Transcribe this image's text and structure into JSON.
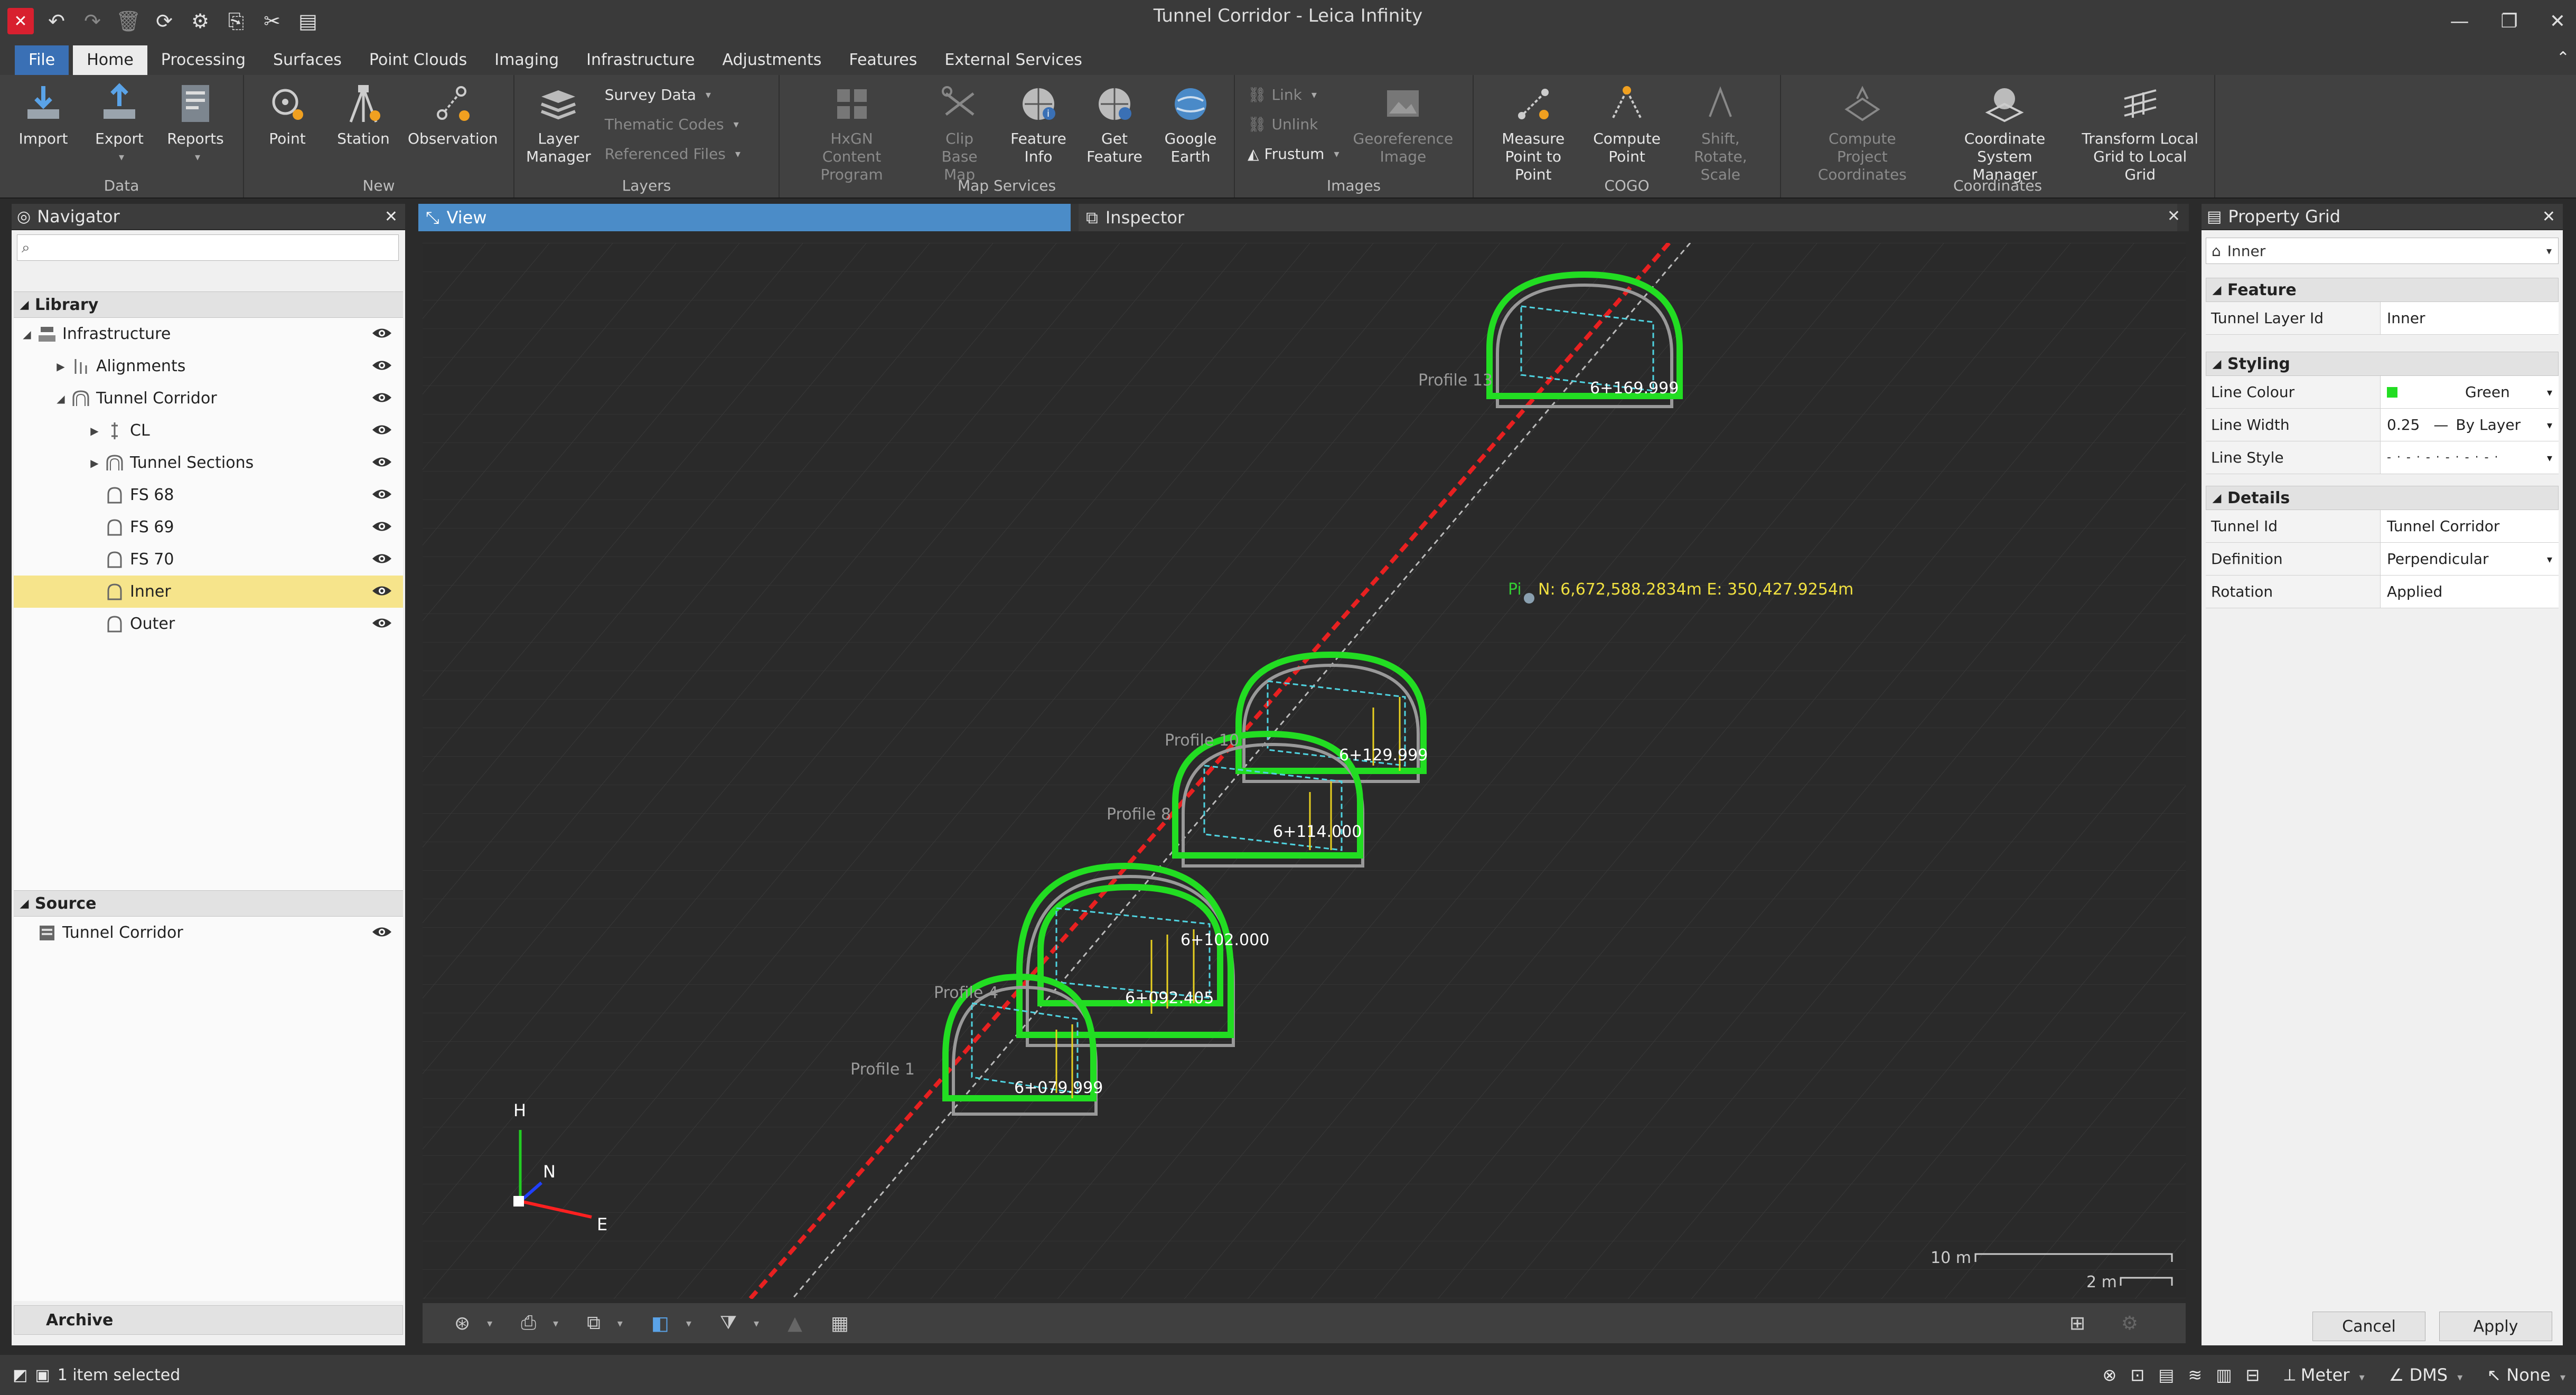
{
  "app": {
    "title": "Tunnel Corridor - Leica Infinity"
  },
  "ribbon_tabs": [
    "File",
    "Home",
    "Processing",
    "Surfaces",
    "Point Clouds",
    "Imaging",
    "Infrastructure",
    "Adjustments",
    "Features",
    "External Services"
  ],
  "ribbon": {
    "data": {
      "label": "Data",
      "import": "Import",
      "export": "Export",
      "reports": "Reports"
    },
    "new": {
      "label": "New",
      "point": "Point",
      "station": "Station",
      "observation": "Observation"
    },
    "layers": {
      "label": "Layers",
      "layer_manager_1": "Layer",
      "layer_manager_2": "Manager",
      "survey_data": "Survey Data",
      "thematic_codes": "Thematic Codes",
      "referenced_files": "Referenced Files"
    },
    "map_services": {
      "label": "Map Services",
      "hxgn_1": "HxGN",
      "hxgn_2": "Content Program",
      "clip_1": "Clip",
      "clip_2": "Base Map",
      "feature_info_1": "Feature",
      "feature_info_2": "Info",
      "get_feature_1": "Get",
      "get_feature_2": "Feature",
      "google_earth_1": "Google",
      "google_earth_2": "Earth"
    },
    "images": {
      "label": "Images",
      "link": "Link",
      "unlink": "Unlink",
      "frustum": "Frustum",
      "georef_1": "Georeference",
      "georef_2": "Image"
    },
    "cogo": {
      "label": "COGO",
      "measure_1": "Measure",
      "measure_2": "Point to Point",
      "compute_point_1": "Compute",
      "compute_point_2": "Point",
      "shift_1": "Shift,",
      "shift_2": "Rotate, Scale"
    },
    "coordinates": {
      "label": "Coordinates",
      "cpc_1": "Compute",
      "cpc_2": "Project Coordinates",
      "csm_1": "Coordinate",
      "csm_2": "System Manager",
      "tlg_1": "Transform Local",
      "tlg_2": "Grid to Local Grid"
    }
  },
  "navigator": {
    "title": "Navigator",
    "library_label": "Library",
    "library_items": [
      {
        "label": "Infrastructure",
        "level": 0,
        "expander": "expanded"
      },
      {
        "label": "Alignments",
        "level": 1,
        "expander": "collapsed"
      },
      {
        "label": "Tunnel Corridor",
        "level": 1,
        "expander": "expanded"
      },
      {
        "label": "CL",
        "level": 2,
        "expander": "collapsed"
      },
      {
        "label": "Tunnel Sections",
        "level": 2,
        "expander": "collapsed"
      },
      {
        "label": "FS 68",
        "level": 2,
        "expander": "none"
      },
      {
        "label": "FS 69",
        "level": 2,
        "expander": "none"
      },
      {
        "label": "FS 70",
        "level": 2,
        "expander": "none"
      },
      {
        "label": "Inner",
        "level": 2,
        "expander": "none",
        "selected": true
      },
      {
        "label": "Outer",
        "level": 2,
        "expander": "none"
      }
    ],
    "source_label": "Source",
    "source_items": [
      {
        "label": "Tunnel Corridor"
      }
    ],
    "archive_label": "Archive"
  },
  "view": {
    "tab_view": "View",
    "tab_inspector": "Inspector",
    "profiles": [
      "Profile 13",
      "Profile 10",
      "Profile 8",
      "Profile 4",
      "Profile 1"
    ],
    "chainages": [
      "6+169.999",
      "6+129.999",
      "6+114.000",
      "6+102.000",
      "6+092.405",
      "6+079.999"
    ],
    "coord_readout": "N: 6,672,588.2834m  E: 350,427.9254m",
    "coord_prefix": "Pi",
    "axis_h": "H",
    "axis_n": "N",
    "axis_e": "E",
    "scale_10m": "10 m",
    "scale_2m": "2 m"
  },
  "property_grid": {
    "title": "Property Grid",
    "selected_object": "Inner",
    "feature_section": "Feature",
    "tunnel_layer_id_key": "Tunnel Layer Id",
    "tunnel_layer_id_val": "Inner",
    "styling_section": "Styling",
    "line_colour_key": "Line Colour",
    "line_colour_val": "Green",
    "line_colour_hex": "#22dd22",
    "line_width_key": "Line Width",
    "line_width_val": "0.25",
    "line_width_layer": "By Layer",
    "line_style_key": "Line Style",
    "details_section": "Details",
    "tunnel_id_key": "Tunnel Id",
    "tunnel_id_val": "Tunnel Corridor",
    "definition_key": "Definition",
    "definition_val": "Perpendicular",
    "rotation_key": "Rotation",
    "rotation_val": "Applied",
    "cancel": "Cancel",
    "apply": "Apply"
  },
  "status": {
    "selection": "1 item selected",
    "unit": "Meter",
    "angle": "DMS",
    "snap": "None"
  }
}
